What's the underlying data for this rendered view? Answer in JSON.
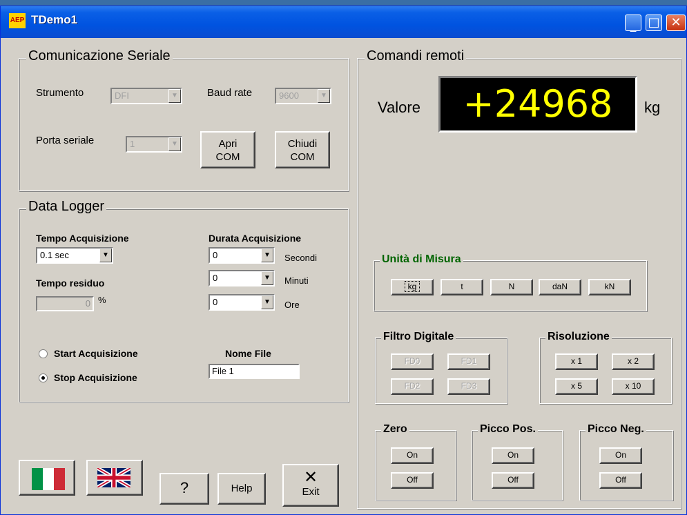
{
  "window": {
    "title": "TDemo1",
    "icon": "app-logo-icon"
  },
  "serial": {
    "legend": "Comunicazione Seriale",
    "strumento_label": "Strumento",
    "strumento_value": "DFI",
    "baud_label": "Baud rate",
    "baud_value": "9600",
    "porta_label": "Porta seriale",
    "porta_value": "1",
    "apri_line1": "Apri",
    "apri_line2": "COM",
    "chiudi_line1": "Chiudi",
    "chiudi_line2": "COM"
  },
  "logger": {
    "legend": "Data Logger",
    "tempo_acq_label": "Tempo Acquisizione",
    "tempo_acq_value": "0.1 sec",
    "durata_label": "Durata Acquisizione",
    "secondi_value": "0",
    "secondi_label": "Secondi",
    "minuti_value": "0",
    "minuti_label": "Minuti",
    "ore_value": "0",
    "ore_label": "Ore",
    "residuo_label": "Tempo residuo",
    "residuo_value": "0",
    "residuo_unit": "%",
    "start_label": "Start Acquisizione",
    "stop_label": "Stop Acquisizione",
    "selected": "stop",
    "nome_file_label": "Nome File",
    "nome_file_value": "File 1"
  },
  "bottom": {
    "flag_it": "italian-flag-icon",
    "flag_en": "uk-flag-icon",
    "question": "?",
    "help": "Help",
    "exit_icon": "✕",
    "exit": "Exit"
  },
  "remote": {
    "legend": "Comandi remoti",
    "valore_label": "Valore",
    "valore_value": "+24968",
    "valore_unit": "kg",
    "display_color": "#ffff00",
    "unita_legend": "Unità di Misura",
    "units": [
      "kg",
      "t",
      "N",
      "daN",
      "kN"
    ],
    "filtro_legend": "Filtro Digitale",
    "filters": [
      "FD0",
      "FD1",
      "FD2",
      "FD3"
    ],
    "risoluzione_legend": "Risoluzione",
    "resolutions": [
      "x 1",
      "x 2",
      "x 5",
      "x 10"
    ],
    "zero_legend": "Zero",
    "picco_pos_legend": "Picco Pos.",
    "picco_neg_legend": "Picco Neg.",
    "on_label": "On",
    "off_label": "Off"
  }
}
